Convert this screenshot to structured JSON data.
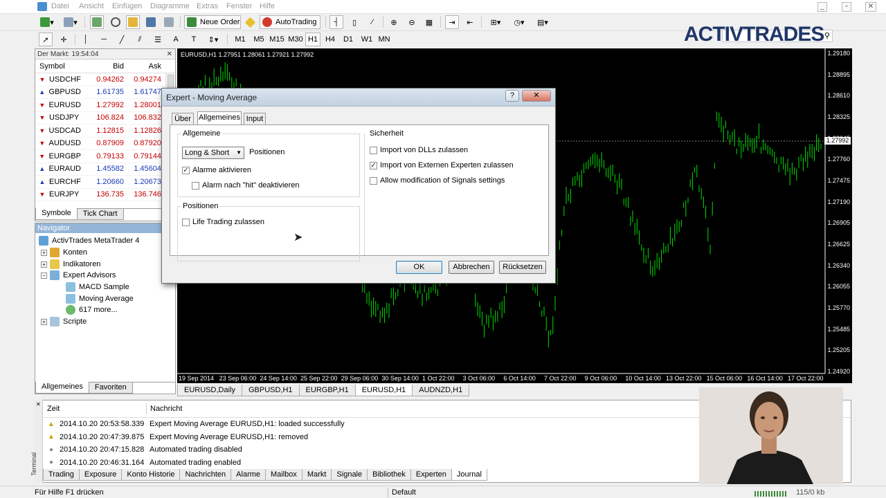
{
  "menu": [
    "Datei",
    "Ansicht",
    "Einfügen",
    "Diagramme",
    "Extras",
    "Fenster",
    "Hilfe"
  ],
  "toolbar": {
    "new_order": "Neue Order",
    "autotrading": "AutoTrading",
    "timeframes": [
      "M1",
      "M5",
      "M15",
      "M30",
      "H1",
      "H4",
      "D1",
      "W1",
      "MN"
    ]
  },
  "brand": {
    "logo": "ActivTrades"
  },
  "market": {
    "title": "Der Markt: 19:54:04",
    "headers": {
      "symbol": "Symbol",
      "bid": "Bid",
      "ask": "Ask"
    },
    "rows": [
      {
        "symbol": "USDCHF",
        "bid": "0.94262",
        "ask": "0.94274",
        "dir": "down"
      },
      {
        "symbol": "GBPUSD",
        "bid": "1.61735",
        "ask": "1.61747",
        "dir": "up"
      },
      {
        "symbol": "EURUSD",
        "bid": "1.27992",
        "ask": "1.28001",
        "dir": "down"
      },
      {
        "symbol": "USDJPY",
        "bid": "106.824",
        "ask": "106.832",
        "dir": "down"
      },
      {
        "symbol": "USDCAD",
        "bid": "1.12815",
        "ask": "1.12826",
        "dir": "down"
      },
      {
        "symbol": "AUDUSD",
        "bid": "0.87909",
        "ask": "0.87920",
        "dir": "down"
      },
      {
        "symbol": "EURGBP",
        "bid": "0.79133",
        "ask": "0.79144",
        "dir": "down"
      },
      {
        "symbol": "EURAUD",
        "bid": "1.45582",
        "ask": "1.45604",
        "dir": "up"
      },
      {
        "symbol": "EURCHF",
        "bid": "1.20660",
        "ask": "1.20673",
        "dir": "up"
      },
      {
        "symbol": "EURJPY",
        "bid": "136.735",
        "ask": "136.746",
        "dir": "down"
      }
    ],
    "tabs": [
      "Symbole",
      "Tick Chart"
    ]
  },
  "navigator": {
    "title": "Navigator",
    "root": "ActivTrades MetaTrader 4",
    "items": [
      "Konten",
      "Indikatoren",
      "Expert Advisors",
      "Scripte"
    ],
    "experts": [
      "MACD Sample",
      "Moving Average",
      "617 more..."
    ],
    "tabs": [
      "Allgemeines",
      "Favoriten"
    ]
  },
  "chart": {
    "label": "EURUSD,H1  1.27951 1.28061 1.27921 1.27992",
    "price_axis": [
      "1.29180",
      "1.28895",
      "1.28610",
      "1.28325",
      "1.28045",
      "1.27760",
      "1.27475",
      "1.27190",
      "1.26905",
      "1.26625",
      "1.26340",
      "1.26055",
      "1.25770",
      "1.25485",
      "1.25205",
      "1.24920"
    ],
    "current_price": "1.27992",
    "time_axis": [
      "19 Sep 2014",
      "23 Sep 06:00",
      "24 Sep 14:00",
      "25 Sep 22:00",
      "29 Sep 06:00",
      "30 Sep 14:00",
      "1 Oct 22:00",
      "3 Oct 06:00",
      "6 Oct 14:00",
      "7 Oct 22:00",
      "9 Oct 06:00",
      "10 Oct 14:00",
      "13 Oct 22:00",
      "15 Oct 06:00",
      "16 Oct 14:00",
      "17 Oct 22:00"
    ],
    "bar_color": "#00e000"
  },
  "chart_tabs": [
    "EURUSD,Daily",
    "GBPUSD,H1",
    "EURGBP,H1",
    "EURUSD,H1",
    "AUDNZD,H1"
  ],
  "dialog": {
    "title": "Expert - Moving Average",
    "tabs": [
      "Über",
      "Allgemeines",
      "Input"
    ],
    "group_general": "Allgemeine",
    "position_select": "Long & Short",
    "position_label": "Positionen",
    "alerts": "Alarme aktivieren",
    "alert_hit": "Alarm nach \"hit\" deaktivieren",
    "group_positions": "Positionen",
    "live_trading": "Life Trading zulassen",
    "group_security": "Sicherheit",
    "allow_dll": "Import von DLLs zulassen",
    "allow_external": "Import von Externen Experten zulassen",
    "allow_signals": "Allow modification of Signals settings",
    "ok": "OK",
    "cancel": "Abbrechen",
    "reset": "Rücksetzen",
    "help_btn": "?",
    "close_btn": "✕"
  },
  "terminal": {
    "side_label": "Terminal",
    "headers": {
      "time": "Zeit",
      "message": "Nachricht"
    },
    "rows": [
      {
        "icon": "warning",
        "time": "2014.10.20 20:53:58.339",
        "msg": "Expert Moving Average EURUSD,H1: loaded successfully"
      },
      {
        "icon": "warning",
        "time": "2014.10.20 20:47:39.875",
        "msg": "Expert Moving Average EURUSD,H1: removed"
      },
      {
        "icon": "info",
        "time": "2014.10.20 20:47:15.828",
        "msg": "Automated trading disabled"
      },
      {
        "icon": "info",
        "time": "2014.10.20 20:46:31.164",
        "msg": "Automated trading enabled"
      }
    ],
    "tabs": [
      "Trading",
      "Exposure",
      "Konto Historie",
      "Nachrichten",
      "Alarme",
      "Mailbox",
      "Markt",
      "Signale",
      "Bibliothek",
      "Experten",
      "Journal"
    ]
  },
  "status": {
    "help": "Für Hilfe F1 drücken",
    "profile": "Default",
    "traffic": "115/0 kb"
  }
}
